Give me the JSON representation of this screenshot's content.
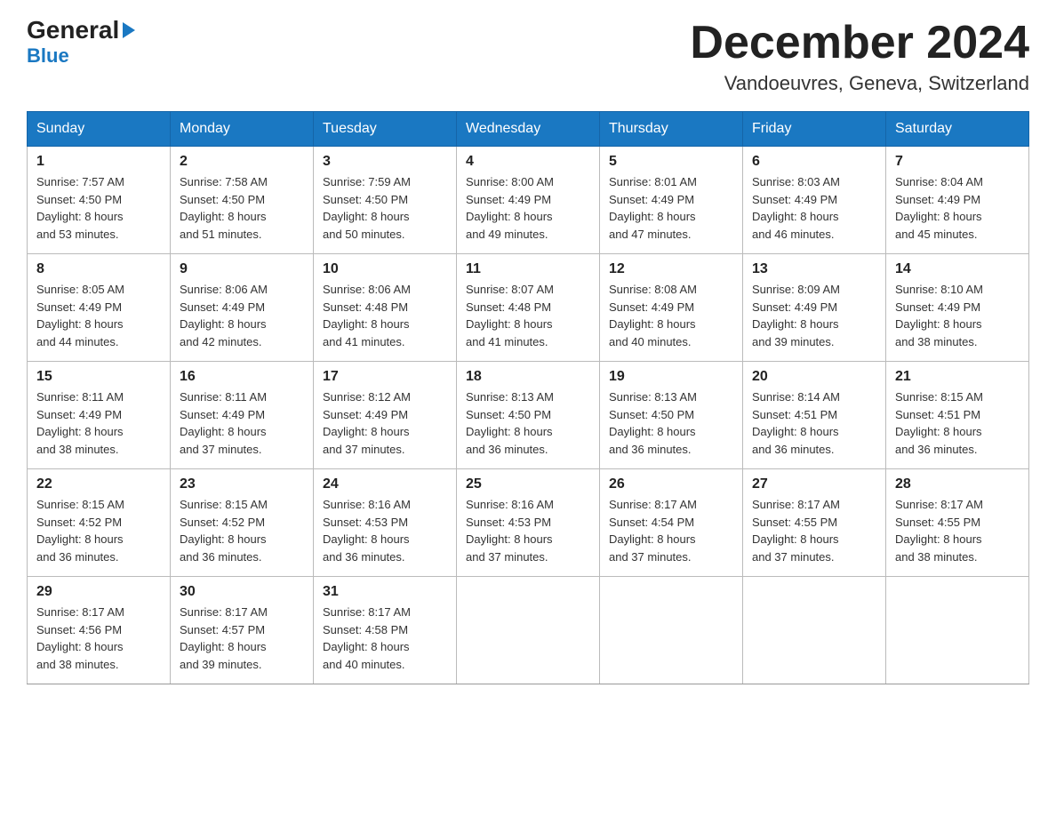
{
  "header": {
    "logo_general": "General",
    "logo_blue": "Blue",
    "month_title": "December 2024",
    "subtitle": "Vandoeuvres, Geneva, Switzerland"
  },
  "days_of_week": [
    "Sunday",
    "Monday",
    "Tuesday",
    "Wednesday",
    "Thursday",
    "Friday",
    "Saturday"
  ],
  "weeks": [
    [
      {
        "day": "1",
        "sunrise": "7:57 AM",
        "sunset": "4:50 PM",
        "daylight": "8 hours and 53 minutes."
      },
      {
        "day": "2",
        "sunrise": "7:58 AM",
        "sunset": "4:50 PM",
        "daylight": "8 hours and 51 minutes."
      },
      {
        "day": "3",
        "sunrise": "7:59 AM",
        "sunset": "4:50 PM",
        "daylight": "8 hours and 50 minutes."
      },
      {
        "day": "4",
        "sunrise": "8:00 AM",
        "sunset": "4:49 PM",
        "daylight": "8 hours and 49 minutes."
      },
      {
        "day": "5",
        "sunrise": "8:01 AM",
        "sunset": "4:49 PM",
        "daylight": "8 hours and 47 minutes."
      },
      {
        "day": "6",
        "sunrise": "8:03 AM",
        "sunset": "4:49 PM",
        "daylight": "8 hours and 46 minutes."
      },
      {
        "day": "7",
        "sunrise": "8:04 AM",
        "sunset": "4:49 PM",
        "daylight": "8 hours and 45 minutes."
      }
    ],
    [
      {
        "day": "8",
        "sunrise": "8:05 AM",
        "sunset": "4:49 PM",
        "daylight": "8 hours and 44 minutes."
      },
      {
        "day": "9",
        "sunrise": "8:06 AM",
        "sunset": "4:49 PM",
        "daylight": "8 hours and 42 minutes."
      },
      {
        "day": "10",
        "sunrise": "8:06 AM",
        "sunset": "4:48 PM",
        "daylight": "8 hours and 41 minutes."
      },
      {
        "day": "11",
        "sunrise": "8:07 AM",
        "sunset": "4:48 PM",
        "daylight": "8 hours and 41 minutes."
      },
      {
        "day": "12",
        "sunrise": "8:08 AM",
        "sunset": "4:49 PM",
        "daylight": "8 hours and 40 minutes."
      },
      {
        "day": "13",
        "sunrise": "8:09 AM",
        "sunset": "4:49 PM",
        "daylight": "8 hours and 39 minutes."
      },
      {
        "day": "14",
        "sunrise": "8:10 AM",
        "sunset": "4:49 PM",
        "daylight": "8 hours and 38 minutes."
      }
    ],
    [
      {
        "day": "15",
        "sunrise": "8:11 AM",
        "sunset": "4:49 PM",
        "daylight": "8 hours and 38 minutes."
      },
      {
        "day": "16",
        "sunrise": "8:11 AM",
        "sunset": "4:49 PM",
        "daylight": "8 hours and 37 minutes."
      },
      {
        "day": "17",
        "sunrise": "8:12 AM",
        "sunset": "4:49 PM",
        "daylight": "8 hours and 37 minutes."
      },
      {
        "day": "18",
        "sunrise": "8:13 AM",
        "sunset": "4:50 PM",
        "daylight": "8 hours and 36 minutes."
      },
      {
        "day": "19",
        "sunrise": "8:13 AM",
        "sunset": "4:50 PM",
        "daylight": "8 hours and 36 minutes."
      },
      {
        "day": "20",
        "sunrise": "8:14 AM",
        "sunset": "4:51 PM",
        "daylight": "8 hours and 36 minutes."
      },
      {
        "day": "21",
        "sunrise": "8:15 AM",
        "sunset": "4:51 PM",
        "daylight": "8 hours and 36 minutes."
      }
    ],
    [
      {
        "day": "22",
        "sunrise": "8:15 AM",
        "sunset": "4:52 PM",
        "daylight": "8 hours and 36 minutes."
      },
      {
        "day": "23",
        "sunrise": "8:15 AM",
        "sunset": "4:52 PM",
        "daylight": "8 hours and 36 minutes."
      },
      {
        "day": "24",
        "sunrise": "8:16 AM",
        "sunset": "4:53 PM",
        "daylight": "8 hours and 36 minutes."
      },
      {
        "day": "25",
        "sunrise": "8:16 AM",
        "sunset": "4:53 PM",
        "daylight": "8 hours and 37 minutes."
      },
      {
        "day": "26",
        "sunrise": "8:17 AM",
        "sunset": "4:54 PM",
        "daylight": "8 hours and 37 minutes."
      },
      {
        "day": "27",
        "sunrise": "8:17 AM",
        "sunset": "4:55 PM",
        "daylight": "8 hours and 37 minutes."
      },
      {
        "day": "28",
        "sunrise": "8:17 AM",
        "sunset": "4:55 PM",
        "daylight": "8 hours and 38 minutes."
      }
    ],
    [
      {
        "day": "29",
        "sunrise": "8:17 AM",
        "sunset": "4:56 PM",
        "daylight": "8 hours and 38 minutes."
      },
      {
        "day": "30",
        "sunrise": "8:17 AM",
        "sunset": "4:57 PM",
        "daylight": "8 hours and 39 minutes."
      },
      {
        "day": "31",
        "sunrise": "8:17 AM",
        "sunset": "4:58 PM",
        "daylight": "8 hours and 40 minutes."
      },
      null,
      null,
      null,
      null
    ]
  ],
  "labels": {
    "sunrise": "Sunrise:",
    "sunset": "Sunset:",
    "daylight": "Daylight:"
  }
}
